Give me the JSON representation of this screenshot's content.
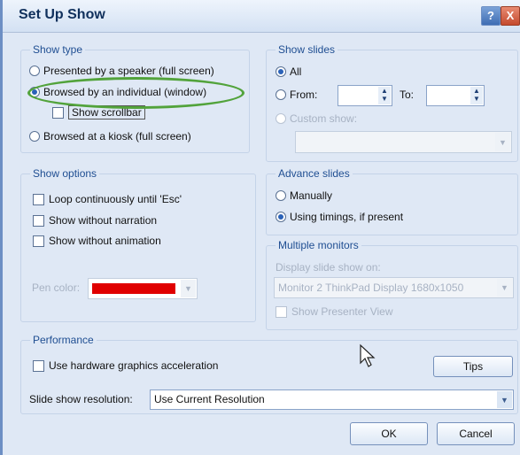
{
  "window": {
    "title": "Set Up Show",
    "help_icon": "?",
    "close_icon": "X"
  },
  "show_type": {
    "legend": "Show type",
    "options": [
      {
        "label": "Presented by a speaker (full screen)",
        "selected": false
      },
      {
        "label": "Browsed by an individual (window)",
        "selected": true
      },
      {
        "label": "Browsed at a kiosk (full screen)",
        "selected": false
      }
    ],
    "show_scrollbar_label": "Show scrollbar"
  },
  "show_slides": {
    "legend": "Show slides",
    "all_label": "All",
    "from_label": "From:",
    "to_label": "To:",
    "custom_label": "Custom show:"
  },
  "show_options": {
    "legend": "Show options",
    "loop_label": "Loop continuously until 'Esc'",
    "narration_label": "Show without narration",
    "animation_label": "Show without animation",
    "pen_color_label": "Pen color:",
    "pen_color": "#e00000"
  },
  "advance_slides": {
    "legend": "Advance slides",
    "manual_label": "Manually",
    "timings_label": "Using timings, if present"
  },
  "multiple_monitors": {
    "legend": "Multiple monitors",
    "display_label": "Display slide show on:",
    "monitor_value": "Monitor 2 ThinkPad Display 1680x1050",
    "presenter_label": "Show Presenter View"
  },
  "performance": {
    "legend": "Performance",
    "hw_accel_label": "Use hardware graphics acceleration",
    "tips_label": "Tips",
    "resolution_label": "Slide show resolution:",
    "resolution_value": "Use Current Resolution"
  },
  "footer": {
    "ok_label": "OK",
    "cancel_label": "Cancel"
  },
  "colors": {
    "highlight_ellipse": "#52a33b",
    "accent": "#1f4e92"
  }
}
